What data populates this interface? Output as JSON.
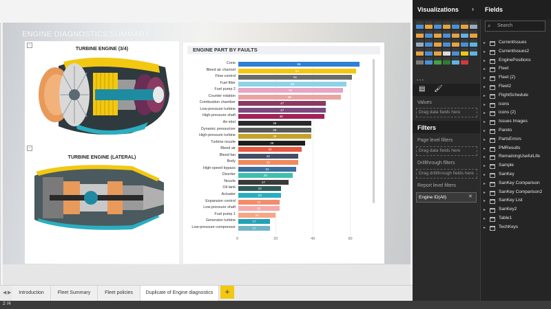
{
  "report": {
    "title": "ENGINE DIAGNOSTICS SUMMARY"
  },
  "engines": {
    "top_title": "TURBINE ENGINE (3/4)",
    "bottom_title": "TURBINE ENGINE (LATERAL)"
  },
  "chart_data": {
    "type": "bar",
    "orientation": "horizontal",
    "title": "ENGINE PART BY FAULTS",
    "xlim": [
      0,
      65
    ],
    "xticks": [
      0,
      20,
      40,
      60
    ],
    "grid": true,
    "categories": [
      "Cone",
      "Bleed air channel",
      "Flow control",
      "Fuel filter",
      "Fuel pump 2",
      "Counter rotation",
      "Combustion chamber",
      "Low-pressure turbine",
      "High-pressure shaft",
      "Air inlet",
      "Dynamic pressurizer",
      "High-pressure turbine",
      "Turbine nozzle",
      "Bleed air",
      "Bleed fan",
      "Body",
      "High-speed bypass",
      "Diverter",
      "Nozzle",
      "Oil tank",
      "Actuator",
      "Expansion control",
      "Low-pressure shaft",
      "Fuel pump 1",
      "Generator turbine",
      "Low-pressure compressor"
    ],
    "values": [
      65,
      63,
      61,
      58,
      56,
      55,
      47,
      47,
      46,
      39,
      39,
      39,
      36,
      34,
      32,
      32,
      31,
      29,
      27,
      23,
      23,
      22,
      22,
      20,
      17,
      17
    ],
    "colors": [
      "#2e7fd6",
      "#f2c811",
      "#6b6b6b",
      "#8dd3e8",
      "#e6a5c3",
      "#e8a5a0",
      "#8b3a62",
      "#7e4a7e",
      "#a0235a",
      "#2a2a2a",
      "#5a5a5a",
      "#c6a12a",
      "#1e1e1e",
      "#e9573f",
      "#444c66",
      "#f08a5d",
      "#3a6fa0",
      "#3dbfb0",
      "#3a3a3a",
      "#2e5b58",
      "#2aaec1",
      "#f28c6b",
      "#f5a9a9",
      "#f7a582",
      "#22a2b5",
      "#6fb5c7"
    ]
  },
  "tabs": [
    "Introduction",
    "Fleet Summary",
    "Fleet policies",
    "Duplicate of Engine diagnostics"
  ],
  "tab_add": "+",
  "nav": {
    "prev": "◀",
    "next": "▶"
  },
  "status": {
    "page": "2 /4"
  },
  "visualizations": {
    "title": "Visualizations",
    "more": "...",
    "values_label": "Values",
    "values_drop": "Drag data fields here",
    "icon_colors": [
      "#4a90d9",
      "#e8a33d",
      "#4a90d9",
      "#e8a33d",
      "#4a90d9",
      "#e8a33d",
      "#9ab",
      "#e8a33d",
      "#4a90d9",
      "#e8a33d",
      "#4a90d9",
      "#e8a33d",
      "#5fb3e6",
      "#e8a33d",
      "#9ab",
      "#4a90d9",
      "#e8a33d",
      "#4a90d9",
      "#e8a33d",
      "#4a90d9",
      "#5fb3e6",
      "#e8a33d",
      "#4a90d9",
      "#e8a33d",
      "#dcdcdc",
      "#4a90d9",
      "#f2c811",
      "#5fb3e6",
      "#7a7a7a",
      "#4a90d9",
      "#43a047",
      "#2e7d32",
      "#5fb3e6",
      "#d23a3a"
    ]
  },
  "filters": {
    "title": "Filters",
    "page_level": "Page level filters",
    "page_drop": "Drag data fields here",
    "drillthrough": "Drillthrough filters",
    "drill_drop": "Drag drillthrough fields here",
    "report_level": "Report level filters",
    "chip": "Engine ID(All)",
    "chip_close": "✕"
  },
  "fields": {
    "title": "Fields",
    "search_placeholder": "Search",
    "items": [
      "CurrentIssues",
      "CurrentIssues2",
      "EnginePositions",
      "Fleet",
      "Fleet (2)",
      "Fleet2",
      "FlightSchedule",
      "icons",
      "icons (2)",
      "Issues Images",
      "Pareto",
      "PartsErrors",
      "PMResults",
      "RemainingUsefulLife",
      "Sample",
      "SanKey",
      "SanKey Comparison",
      "SanKey Comparison2",
      "SanKey List",
      "SanKey2",
      "Table1",
      "TechKeys"
    ]
  }
}
